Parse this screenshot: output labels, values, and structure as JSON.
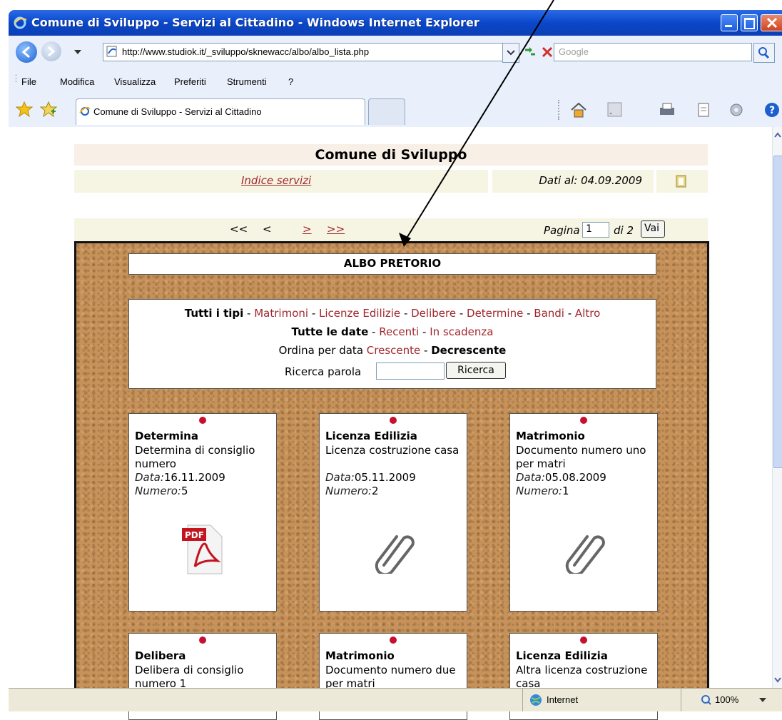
{
  "window": {
    "title": "Comune di Sviluppo - Servizi al Cittadino - Windows Internet Explorer"
  },
  "address": {
    "url": "http://www.studiok.it/_sviluppo/sknewacc/albo/albo_lista.php",
    "search_placeholder": "Google"
  },
  "menu": [
    "File",
    "Modifica",
    "Visualizza",
    "Preferiti",
    "Strumenti",
    "?"
  ],
  "tab": {
    "title": "Comune di Sviluppo - Servizi al Cittadino"
  },
  "page": {
    "site_title": "Comune di Sviluppo",
    "services_link": "Indice servizi",
    "date_info": "Dati al: 04.09.2009",
    "pager": {
      "first": "<<",
      "prev": "<",
      "next": ">",
      "last": ">>",
      "page_label": "Pagina",
      "page_value": "1",
      "of_label": "di 2",
      "go": "Vai"
    },
    "board_title": "ALBO PRETORIO",
    "filters": {
      "all_types": "Tutti i tipi",
      "types": [
        "Matrimoni",
        "Licenze Edilizie",
        "Delibere",
        "Determine",
        "Bandi",
        "Altro"
      ],
      "all_dates": "Tutte le date",
      "dates": [
        "Recenti",
        "In scadenza"
      ],
      "order_label": "Ordina per data",
      "order_asc": "Crescente",
      "order_desc": "Decrescente",
      "search_label": "Ricerca parola",
      "search_button": "Ricerca"
    },
    "cards": [
      {
        "title": "Determina",
        "desc": "Determina di consiglio numero",
        "date_label": "Data:",
        "date": "16.11.2009",
        "num_label": "Numero:",
        "num": "5",
        "icon": "pdf-icon"
      },
      {
        "title": "Licenza Edilizia",
        "desc": "Licenza costruzione casa",
        "date_label": "Data:",
        "date": "05.11.2009",
        "num_label": "Numero:",
        "num": "2",
        "icon": "paperclip-icon"
      },
      {
        "title": "Matrimonio",
        "desc": "Documento numero uno per matri",
        "date_label": "Data:",
        "date": "05.08.2009",
        "num_label": "Numero:",
        "num": "1",
        "icon": "paperclip-icon"
      },
      {
        "title": "Delibera",
        "desc": "Delibera di consiglio numero 1"
      },
      {
        "title": "Matrimonio",
        "desc": "Documento numero due per matri"
      },
      {
        "title": "Licenza Edilizia",
        "desc": "Altra licenza costruzione casa"
      }
    ]
  },
  "status": {
    "zone": "Internet",
    "zoom": "100%"
  },
  "colors": {
    "link": "#a0282d",
    "titlebar": "#0a47c9",
    "cork": "#c6925a"
  }
}
